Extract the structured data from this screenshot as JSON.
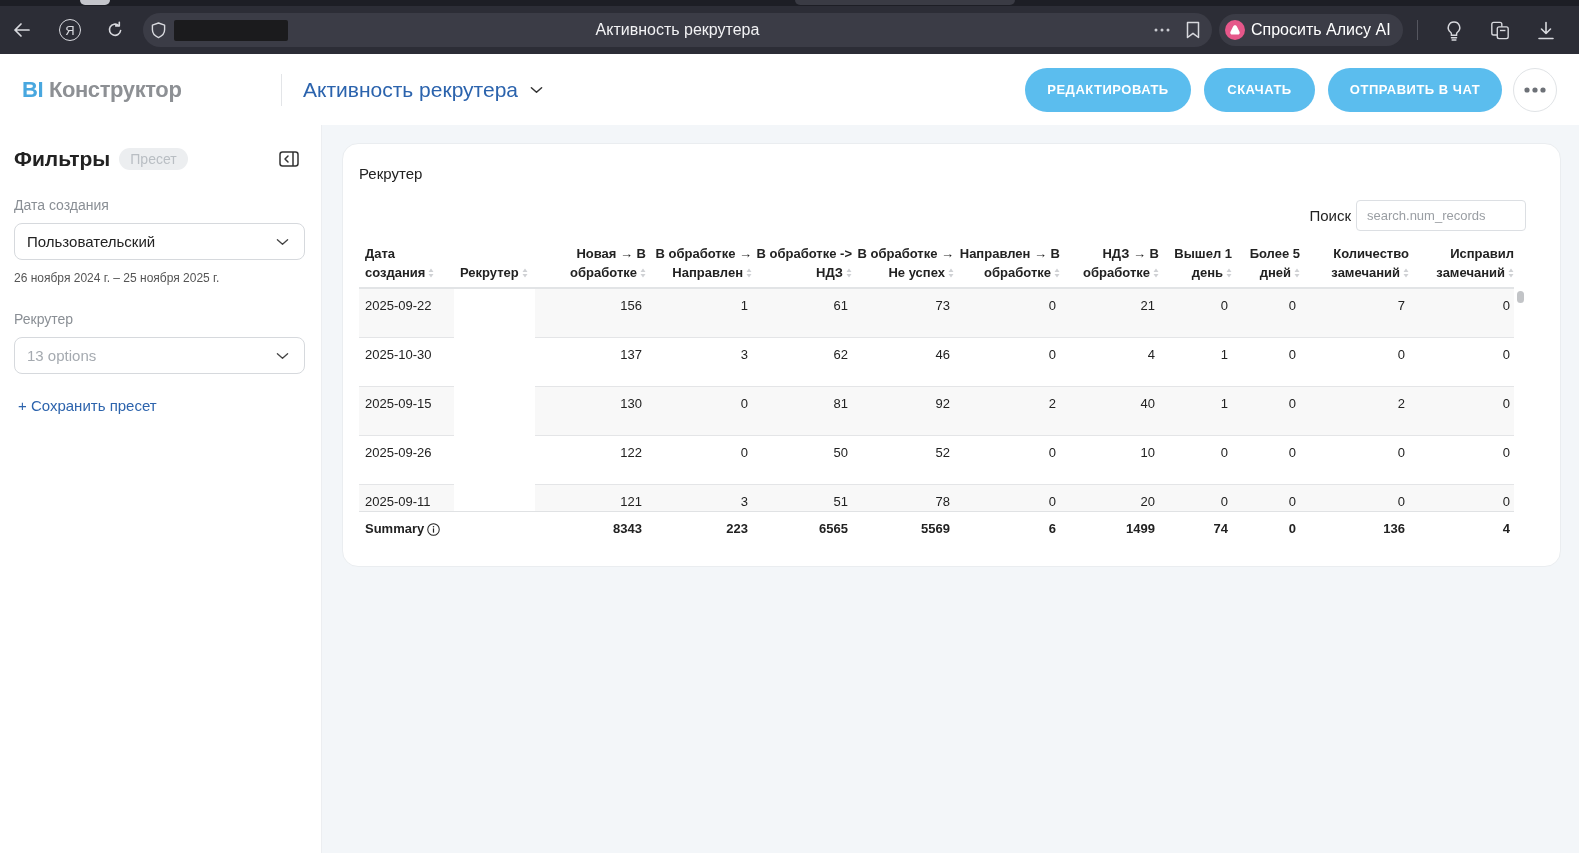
{
  "browser": {
    "home_glyph": "Я",
    "page_title": "Активность рекрутера",
    "assistant_button": "Спросить Алису AI"
  },
  "header": {
    "logo": {
      "accent": "BI",
      "name": "Конструктор"
    },
    "dashboard_title": "Активность рекрутера",
    "actions": [
      "РЕДАКТИРОВАТЬ",
      "СКАЧАТЬ",
      "ОТПРАВИТЬ В ЧАТ"
    ]
  },
  "filters": {
    "title": "Фильтры",
    "preset_badge": {
      "label": "Пресет",
      "disabled": true
    },
    "fields": [
      {
        "label": "Дата создания",
        "value": "Пользовательский",
        "hint": "26 ноября 2024 г. – 25 ноября 2025 г."
      },
      {
        "label": "Рекрутер",
        "placeholder": "13 options"
      }
    ],
    "save_preset": "+ Сохранить пресет"
  },
  "widget": {
    "title": "Рекрутер",
    "search": {
      "label": "Поиск",
      "placeholder": "search.num_records"
    },
    "table": {
      "columns": [
        {
          "label": "Дата создания",
          "kind": "date"
        },
        {
          "label": "Рекрутер",
          "kind": "text"
        },
        {
          "label": "Новая → В обработке",
          "kind": "number"
        },
        {
          "label": "В обработке → Направлен",
          "kind": "number"
        },
        {
          "label": "В обработке -> НДЗ",
          "kind": "number"
        },
        {
          "label": "В обработке → Не успех",
          "kind": "number"
        },
        {
          "label": "Направлен → В обработке",
          "kind": "number"
        },
        {
          "label": "НДЗ → В обработке",
          "kind": "number"
        },
        {
          "label": "Вышел 1 день",
          "kind": "number"
        },
        {
          "label": "Более 5 дней",
          "kind": "number"
        },
        {
          "label": "Количество замечаний",
          "kind": "number"
        },
        {
          "label": "Исправил замечаний",
          "kind": "number"
        }
      ],
      "rows": [
        {
          "date": "2025-09-22",
          "counts": [
            "156",
            "1",
            "61",
            "73",
            "0",
            "21",
            "0",
            "0",
            "7",
            "0"
          ]
        },
        {
          "date": "2025-10-30",
          "counts": [
            "137",
            "3",
            "62",
            "46",
            "0",
            "4",
            "1",
            "0",
            "0",
            "0"
          ]
        },
        {
          "date": "2025-09-15",
          "counts": [
            "130",
            "0",
            "81",
            "92",
            "2",
            "40",
            "1",
            "0",
            "2",
            "0"
          ]
        },
        {
          "date": "2025-09-26",
          "counts": [
            "122",
            "0",
            "50",
            "52",
            "0",
            "10",
            "0",
            "0",
            "0",
            "0"
          ]
        },
        {
          "date": "2025-09-11",
          "counts": [
            "121",
            "3",
            "51",
            "78",
            "0",
            "20",
            "0",
            "0",
            "0",
            "0"
          ]
        }
      ],
      "summary": {
        "label": "Summary",
        "values": [
          "8343",
          "223",
          "6565",
          "5569",
          "6",
          "1499",
          "74",
          "0",
          "136",
          "4"
        ]
      }
    }
  }
}
